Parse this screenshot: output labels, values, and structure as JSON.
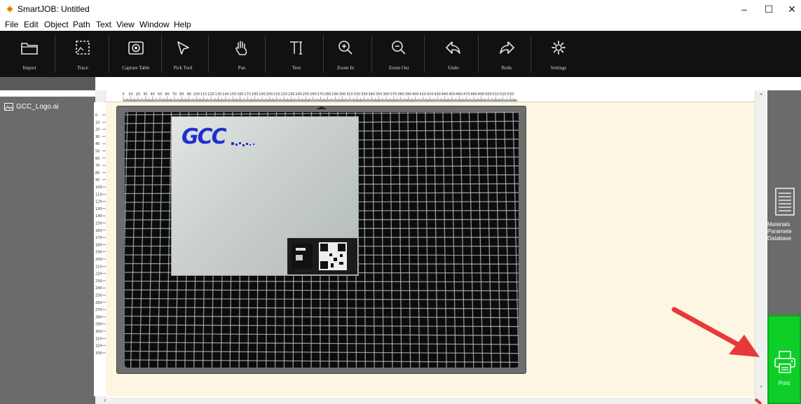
{
  "window": {
    "title": "SmartJOB: Untitled",
    "minimize_glyph": "–",
    "maximize_glyph": "☐",
    "close_glyph": "✕"
  },
  "menu": [
    "File",
    "Edit",
    "Object",
    "Path",
    "Text",
    "View",
    "Window",
    "Help"
  ],
  "toolbar": [
    {
      "label": "Import",
      "icon": "folder-icon"
    },
    {
      "label": "Trace",
      "icon": "trace-icon"
    },
    {
      "label": "Capture Table",
      "icon": "camera-icon"
    },
    {
      "label": "Pick Tool",
      "icon": "pointer-icon"
    },
    {
      "label": "Pan",
      "icon": "hand-icon"
    },
    {
      "label": "Text",
      "icon": "text-icon"
    },
    {
      "label": "Zoom In",
      "icon": "zoom-in-icon"
    },
    {
      "label": "Zoom Out",
      "icon": "zoom-out-icon"
    },
    {
      "label": "Undo",
      "icon": "undo-icon"
    },
    {
      "label": "Redo",
      "icon": "redo-icon"
    },
    {
      "label": "Settings",
      "icon": "gear-icon"
    }
  ],
  "layers": {
    "file_name": "GCC_Logo.ai"
  },
  "ruler": {
    "horizontal": [
      "0",
      "10",
      "20",
      "30",
      "40",
      "50",
      "60",
      "70",
      "80",
      "90",
      "100",
      "110",
      "120",
      "130",
      "140",
      "150",
      "160",
      "170",
      "180",
      "190",
      "200",
      "210",
      "220",
      "230",
      "240",
      "250",
      "260",
      "270",
      "280",
      "290",
      "300",
      "310",
      "320",
      "330",
      "340",
      "350",
      "360",
      "370",
      "380",
      "390",
      "400",
      "410",
      "420",
      "430",
      "440",
      "450",
      "460",
      "470",
      "480",
      "490",
      "500",
      "510",
      "520",
      "530"
    ],
    "vertical": [
      "0",
      "10",
      "20",
      "30",
      "40",
      "50",
      "60",
      "70",
      "80",
      "90",
      "100",
      "110",
      "120",
      "130",
      "140",
      "150",
      "160",
      "170",
      "180",
      "190",
      "200",
      "210",
      "220",
      "230",
      "240",
      "250",
      "260",
      "270",
      "280",
      "290",
      "300",
      "310",
      "320",
      "330"
    ]
  },
  "canvas": {
    "logo_text": "GCC"
  },
  "right_panel": {
    "materials_label": "Materials\nParamete\nDatabase",
    "print_label": "Print"
  },
  "colors": {
    "toolbar_bg": "#111111",
    "panel_bg": "#6b6b6b",
    "workspace_bg": "#fdf6e2",
    "print_bg": "#0ece28",
    "arrow": "#e8393a",
    "logo": "#1f2fd2"
  }
}
